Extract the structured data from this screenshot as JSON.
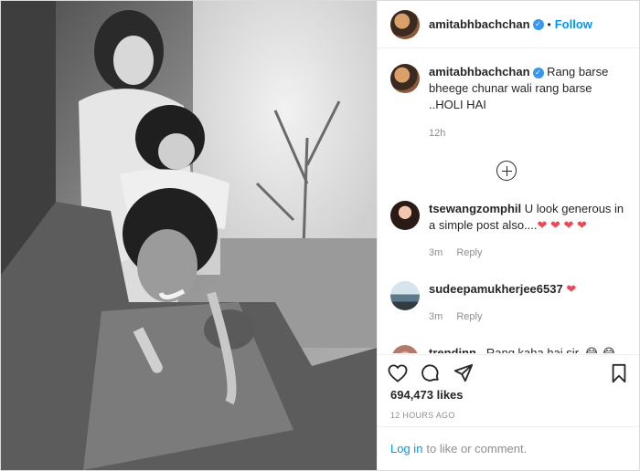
{
  "header": {
    "username": "amitabhbachchan",
    "separator": "•",
    "follow_label": "Follow"
  },
  "caption": {
    "username": "amitabhbachchan",
    "text": "Rang barse bheege chunar wali rang barse ..HOLI HAI",
    "time": "12h"
  },
  "comments": [
    {
      "username": "tsewangzomphil",
      "text": "U look generous in a simple post also....",
      "emoji": "❤ ❤ ❤ ❤",
      "time": "3m",
      "reply": "Reply"
    },
    {
      "username": "sudeepamukherjee6537",
      "text": "",
      "emoji": "❤",
      "time": "3m",
      "reply": "Reply"
    },
    {
      "username": "trendinn_",
      "text": "Rang kaha hai sir..",
      "emoji": "😂 😂 😂 😂 😂",
      "time": "",
      "reply": ""
    }
  ],
  "likes": "694,473 likes",
  "posted_ago": "12 HOURS AGO",
  "footer": {
    "login": "Log in",
    "rest": "to like or comment."
  },
  "icons": {
    "verified": "verified-badge-icon",
    "add_comment": "plus-circle-icon",
    "like": "heart-icon",
    "comment": "comment-icon",
    "share": "paper-plane-icon",
    "save": "bookmark-icon"
  },
  "colors": {
    "link": "#0095f6",
    "verified": "#3897f0",
    "heart": "#ed4956",
    "muted": "#8e8e8e"
  }
}
